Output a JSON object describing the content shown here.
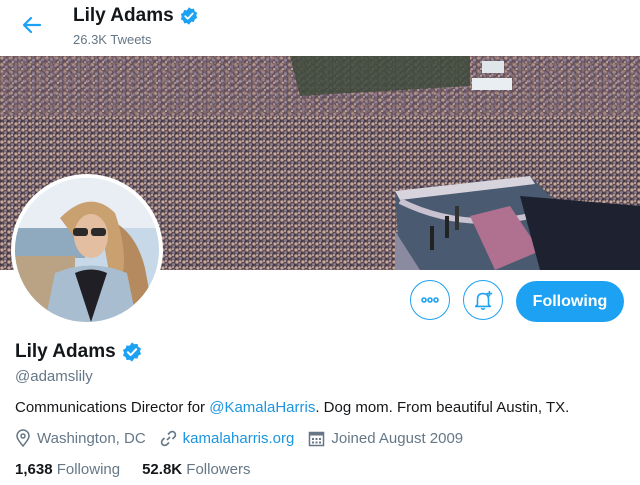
{
  "header": {
    "name": "Lily Adams",
    "tweet_count": "26.3K Tweets"
  },
  "profile": {
    "name": "Lily Adams",
    "handle": "@adamslily",
    "bio_prefix": "Communications Director for ",
    "bio_mention": "@KamalaHarris",
    "bio_suffix": ". Dog mom. From beautiful Austin, TX.",
    "location": "Washington, DC",
    "website": "kamalaharris.org",
    "joined": "Joined August 2009",
    "following_count": "1,638",
    "following_label": "Following",
    "followers_count": "52.8K",
    "followers_label": "Followers"
  },
  "actions": {
    "following_button": "Following"
  },
  "colors": {
    "accent": "#1da1f2",
    "link": "#1b95e0",
    "muted": "#657786",
    "verified": "#1da1f2"
  },
  "icons": [
    "back-arrow-icon",
    "verified-badge-icon",
    "more-icon",
    "bell-plus-icon",
    "location-pin-icon",
    "link-icon",
    "calendar-icon"
  ]
}
